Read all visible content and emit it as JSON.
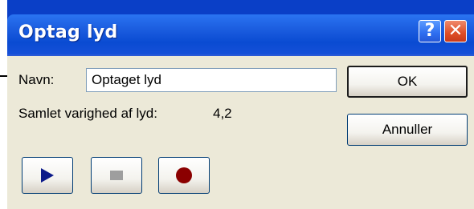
{
  "window": {
    "title": "Optag lyd",
    "help_label": "?",
    "close_label": "✕"
  },
  "form": {
    "name_label": "Navn:",
    "name_value": "Optaget lyd",
    "duration_label": "Samlet varighed af lyd:",
    "duration_value": "4,2"
  },
  "buttons": {
    "ok_label": "OK",
    "cancel_label": "Annuller"
  },
  "media": {
    "play_icon": "play-icon",
    "stop_icon": "stop-icon",
    "record_icon": "record-icon",
    "play_color": "#0c1a8a",
    "stop_color": "#9e9e9e",
    "record_color": "#8b0000"
  }
}
